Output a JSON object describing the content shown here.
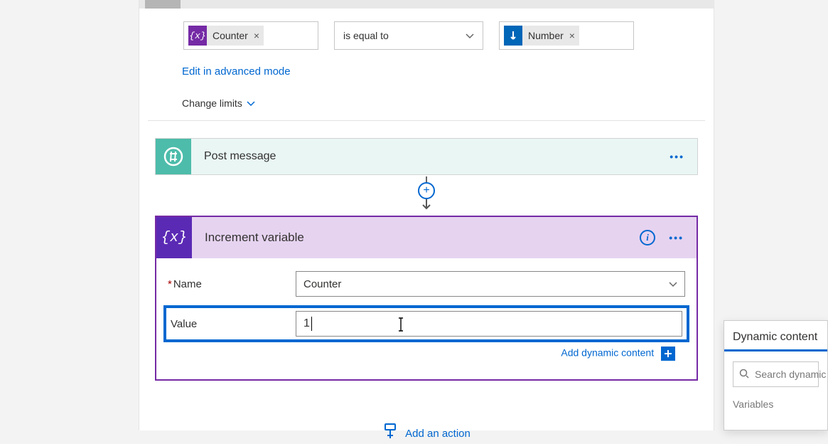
{
  "condition": {
    "left_token": {
      "label": "Counter",
      "icon_name": "variable-icon"
    },
    "operator": "is equal to",
    "right_token": {
      "label": "Number",
      "icon_name": "number-icon"
    }
  },
  "links": {
    "edit_advanced": "Edit in advanced mode",
    "change_limits": "Change limits",
    "add_dynamic": "Add dynamic content",
    "add_action": "Add an action"
  },
  "post_message_card": {
    "title": "Post message"
  },
  "increment_card": {
    "title": "Increment variable",
    "fields": {
      "name_label": "Name",
      "name_value": "Counter",
      "value_label": "Value",
      "value_value": "1"
    }
  },
  "dynamic_panel": {
    "tab": "Dynamic content",
    "search_placeholder": "Search dynamic content",
    "group": "Variables"
  }
}
